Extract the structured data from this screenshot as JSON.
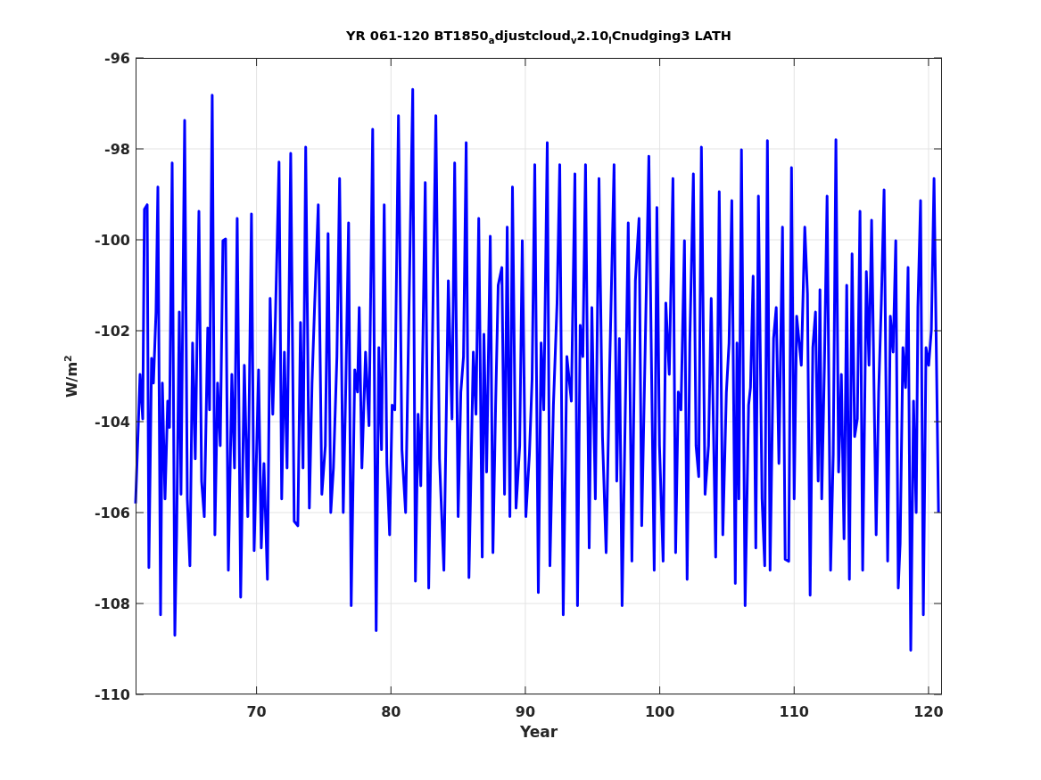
{
  "figure": {
    "chart_data": {
      "type": "line",
      "grid": true,
      "title": "YR 061-120 BT1850$_{a}$djustcloud$_{v}$2.10$_{l}$Cnudging3 LATH",
      "xlabel": "Year",
      "ylabel": "W/m$^{2}$",
      "xlim": [
        61,
        121
      ],
      "ylim": [
        -110,
        -96
      ],
      "xticks": [
        70,
        80,
        90,
        100,
        110,
        120
      ],
      "yticks": [
        -110,
        -108,
        -106,
        -104,
        -102,
        -100,
        -98,
        -96
      ],
      "x": [
        61.0,
        61.33,
        61.53,
        61.66,
        61.86,
        61.99,
        62.19,
        62.33,
        62.52,
        62.66,
        62.86,
        62.99,
        63.19,
        63.39,
        63.52,
        63.72,
        63.92,
        64.05,
        64.25,
        64.38,
        64.65,
        64.85,
        65.04,
        65.24,
        65.44,
        65.71,
        65.91,
        66.11,
        66.37,
        66.5,
        66.7,
        66.9,
        67.1,
        67.3,
        67.5,
        67.7,
        67.9,
        68.16,
        68.36,
        68.56,
        68.82,
        69.09,
        69.35,
        69.62,
        69.82,
        70.15,
        70.35,
        70.55,
        70.81,
        71.01,
        71.21,
        71.41,
        71.67,
        71.87,
        72.07,
        72.27,
        72.54,
        72.8,
        73.07,
        73.27,
        73.46,
        73.66,
        73.93,
        74.13,
        74.33,
        74.59,
        74.86,
        75.12,
        75.32,
        75.52,
        75.72,
        75.98,
        76.18,
        76.45,
        76.65,
        76.85,
        77.04,
        77.31,
        77.51,
        77.64,
        77.84,
        78.11,
        78.37,
        78.64,
        78.9,
        79.1,
        79.3,
        79.5,
        79.7,
        79.9,
        80.09,
        80.29,
        80.56,
        80.82,
        81.09,
        81.35,
        81.62,
        81.82,
        82.02,
        82.22,
        82.55,
        82.81,
        83.01,
        83.34,
        83.61,
        83.94,
        84.27,
        84.54,
        84.74,
        85.0,
        85.2,
        85.4,
        85.6,
        85.8,
        86.13,
        86.33,
        86.53,
        86.79,
        86.92,
        87.12,
        87.39,
        87.59,
        87.79,
        87.98,
        88.25,
        88.45,
        88.65,
        88.85,
        89.04,
        89.31,
        89.58,
        89.77,
        90.04,
        90.3,
        90.5,
        90.7,
        90.97,
        91.17,
        91.37,
        91.63,
        91.83,
        92.09,
        92.36,
        92.56,
        92.82,
        93.09,
        93.42,
        93.69,
        93.88,
        94.08,
        94.28,
        94.48,
        94.75,
        94.95,
        95.21,
        95.48,
        95.74,
        96.01,
        96.27,
        96.6,
        96.8,
        97.0,
        97.2,
        97.47,
        97.66,
        97.93,
        98.19,
        98.46,
        98.66,
        98.92,
        99.19,
        99.39,
        99.59,
        99.79,
        99.98,
        100.25,
        100.45,
        100.71,
        100.98,
        101.18,
        101.38,
        101.58,
        101.84,
        102.04,
        102.24,
        102.5,
        102.7,
        102.9,
        103.1,
        103.37,
        103.63,
        103.83,
        104.16,
        104.43,
        104.69,
        104.96,
        105.16,
        105.36,
        105.62,
        105.75,
        105.89,
        106.08,
        106.35,
        106.61,
        106.75,
        106.95,
        107.15,
        107.34,
        107.61,
        107.81,
        108.01,
        108.21,
        108.47,
        108.67,
        108.87,
        109.13,
        109.33,
        109.6,
        109.8,
        110.0,
        110.19,
        110.53,
        110.79,
        110.99,
        111.19,
        111.39,
        111.59,
        111.79,
        111.92,
        112.05,
        112.25,
        112.45,
        112.71,
        112.91,
        113.11,
        113.31,
        113.51,
        113.71,
        113.91,
        114.11,
        114.31,
        114.5,
        114.7,
        114.9,
        115.1,
        115.37,
        115.57,
        115.76,
        116.1,
        116.29,
        116.49,
        116.69,
        116.96,
        117.16,
        117.36,
        117.56,
        117.75,
        117.89,
        118.09,
        118.29,
        118.48,
        118.68,
        118.88,
        119.08,
        119.21,
        119.41,
        119.61,
        119.81,
        120.01,
        120.21,
        120.41,
        120.74
      ],
      "series": [
        {
          "color": "#0000ff",
          "values": [
            -105.8,
            -102.96,
            -103.94,
            -99.33,
            -99.23,
            -107.21,
            -102.61,
            -103.15,
            -101.59,
            -98.84,
            -108.25,
            -103.15,
            -105.7,
            -103.55,
            -104.13,
            -98.31,
            -108.7,
            -106.49,
            -101.59,
            -105.6,
            -97.37,
            -105.7,
            -107.17,
            -102.27,
            -104.82,
            -99.37,
            -105.31,
            -106.09,
            -101.94,
            -103.74,
            -96.82,
            -106.49,
            -103.15,
            -104.53,
            -100.02,
            -99.98,
            -107.27,
            -102.96,
            -105.02,
            -99.53,
            -107.86,
            -102.76,
            -106.09,
            -99.43,
            -106.84,
            -102.86,
            -106.78,
            -104.92,
            -107.47,
            -101.29,
            -103.84,
            -101.68,
            -98.29,
            -105.7,
            -102.47,
            -105.02,
            -98.1,
            -106.19,
            -106.29,
            -101.82,
            -105.02,
            -97.96,
            -105.9,
            -103.15,
            -101.39,
            -99.23,
            -105.6,
            -104.53,
            -99.86,
            -106.0,
            -105.02,
            -102.57,
            -98.65,
            -106.0,
            -103.06,
            -99.63,
            -108.05,
            -102.86,
            -103.35,
            -101.49,
            -105.02,
            -102.47,
            -104.09,
            -97.57,
            -108.6,
            -102.37,
            -104.62,
            -99.23,
            -104.92,
            -106.49,
            -103.64,
            -103.74,
            -97.27,
            -104.62,
            -106.0,
            -101.39,
            -96.69,
            -107.51,
            -103.84,
            -105.41,
            -98.74,
            -107.66,
            -103.78,
            -97.27,
            -104.82,
            -107.27,
            -100.9,
            -103.94,
            -98.31,
            -106.09,
            -103.35,
            -102.57,
            -97.86,
            -107.43,
            -102.47,
            -103.84,
            -99.53,
            -106.98,
            -102.08,
            -105.11,
            -99.92,
            -106.88,
            -103.64,
            -101.0,
            -100.61,
            -105.6,
            -99.72,
            -106.09,
            -98.84,
            -105.9,
            -104.53,
            -100.02,
            -106.09,
            -104.72,
            -103.06,
            -98.35,
            -107.76,
            -102.27,
            -103.74,
            -97.86,
            -107.17,
            -103.64,
            -101.39,
            -98.35,
            -108.25,
            -102.57,
            -103.55,
            -98.55,
            -108.05,
            -101.88,
            -102.57,
            -98.35,
            -106.78,
            -101.49,
            -105.7,
            -98.65,
            -104.33,
            -106.88,
            -102.86,
            -98.35,
            -105.31,
            -102.17,
            -108.05,
            -103.15,
            -99.63,
            -107.07,
            -100.9,
            -99.53,
            -106.29,
            -102.37,
            -98.16,
            -102.86,
            -107.27,
            -99.29,
            -104.53,
            -107.07,
            -101.39,
            -102.96,
            -98.65,
            -106.88,
            -103.35,
            -103.74,
            -100.02,
            -107.47,
            -102.27,
            -98.55,
            -104.53,
            -105.21,
            -97.96,
            -105.6,
            -104.53,
            -101.29,
            -106.98,
            -98.94,
            -106.49,
            -103.35,
            -102.27,
            -99.14,
            -107.56,
            -102.27,
            -105.7,
            -98.02,
            -108.05,
            -103.64,
            -103.25,
            -100.8,
            -106.78,
            -99.04,
            -105.7,
            -107.17,
            -97.82,
            -107.27,
            -102.17,
            -101.49,
            -104.92,
            -99.72,
            -107.03,
            -107.07,
            -98.41,
            -105.7,
            -101.68,
            -102.76,
            -99.72,
            -101.19,
            -107.82,
            -102.37,
            -101.59,
            -105.31,
            -101.1,
            -105.7,
            -102.76,
            -99.04,
            -107.27,
            -104.72,
            -97.8,
            -105.11,
            -102.96,
            -106.58,
            -101.0,
            -107.47,
            -100.31,
            -104.33,
            -103.94,
            -99.37,
            -107.27,
            -100.7,
            -102.76,
            -99.57,
            -106.49,
            -103.35,
            -101.39,
            -98.9,
            -107.07,
            -101.68,
            -102.47,
            -100.02,
            -107.66,
            -106.68,
            -102.37,
            -103.25,
            -100.61,
            -109.03,
            -103.55,
            -106.0,
            -101.49,
            -99.14,
            -108.25,
            -102.37,
            -102.76,
            -101.98,
            -98.65,
            -106.0
          ]
        }
      ]
    }
  }
}
